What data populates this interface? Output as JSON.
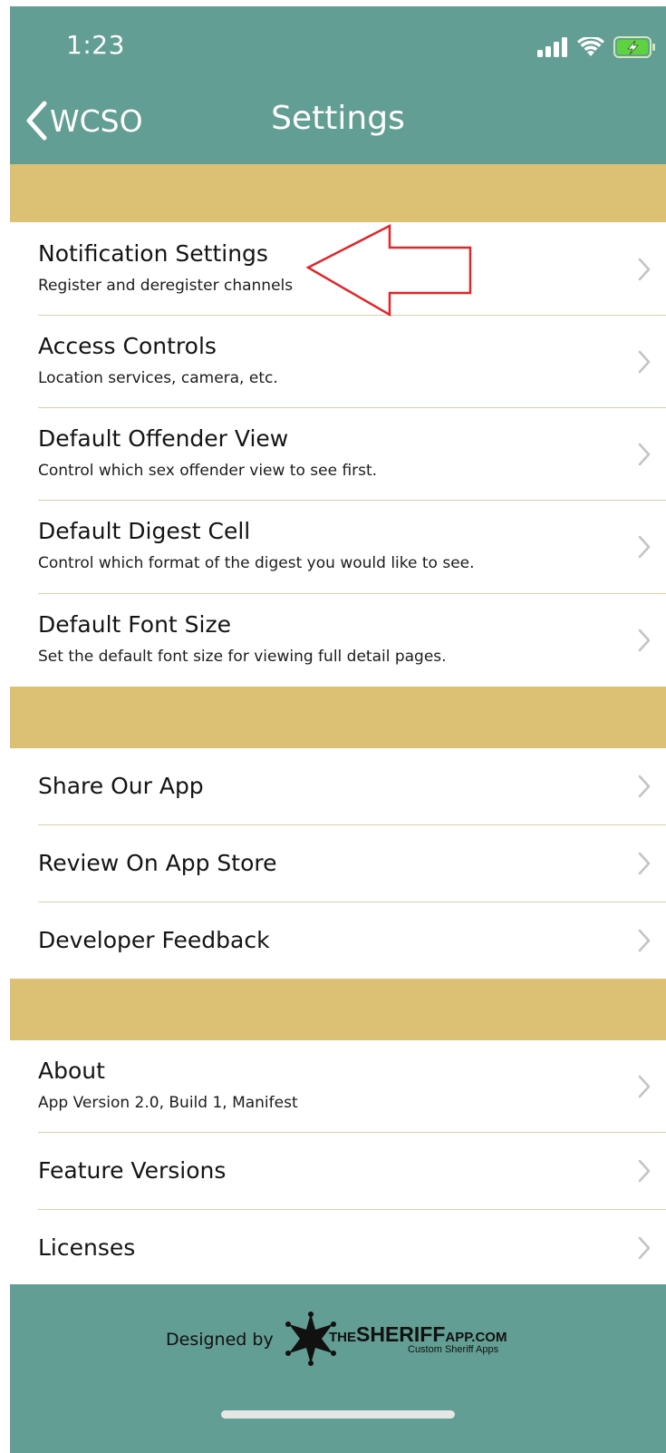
{
  "status_bar": {
    "time": "1:23",
    "signal_icon": "signal-icon",
    "wifi_icon": "wifi-icon",
    "battery_icon": "battery-charging-icon"
  },
  "nav": {
    "back_label": "WCSO",
    "title": "Settings"
  },
  "section1": [
    {
      "title": "Notification Settings",
      "subtitle": "Register and deregister channels"
    },
    {
      "title": "Access Controls",
      "subtitle": "Location services, camera, etc."
    },
    {
      "title": "Default Offender View",
      "subtitle": "Control which sex offender view to see first."
    },
    {
      "title": "Default Digest Cell",
      "subtitle": "Control which format of the digest you would like to see."
    },
    {
      "title": "Default Font Size",
      "subtitle": "Set the default font size for viewing full detail pages."
    }
  ],
  "section2": [
    {
      "title": "Share Our App"
    },
    {
      "title": "Review On App Store"
    },
    {
      "title": "Developer Feedback"
    }
  ],
  "section3": [
    {
      "title": "About",
      "subtitle": "App Version 2.0, Build 1, Manifest"
    },
    {
      "title": "Feature Versions"
    },
    {
      "title": "Licenses"
    }
  ],
  "footer": {
    "designed_by": "Designed by",
    "logo_the": "THE",
    "logo_sheriff": "SHERIFF",
    "logo_com": "APP.COM",
    "logo_tagline": "Custom Sheriff Apps"
  },
  "colors": {
    "header": "#629e93",
    "section_band": "#dcc073",
    "annotation_arrow": "#e0262b"
  }
}
